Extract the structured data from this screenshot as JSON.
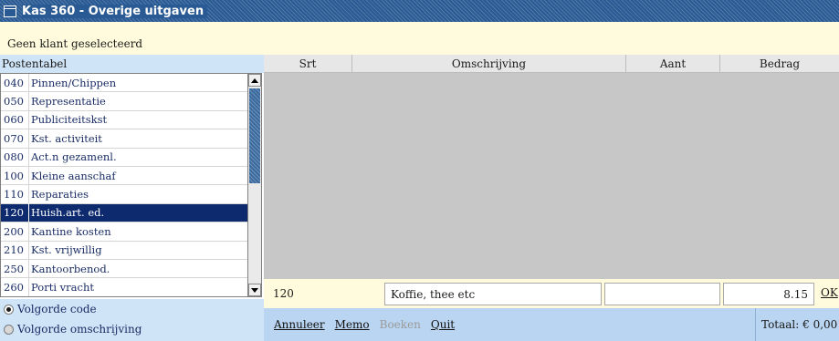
{
  "window": {
    "title": "Kas 360 - Overige uitgaven"
  },
  "customer": {
    "status": "Geen klant geselecteerd"
  },
  "postentabel": {
    "header": "Postentabel",
    "items": [
      {
        "code": "040",
        "label": "Pinnen/Chippen",
        "selected": false
      },
      {
        "code": "050",
        "label": "Representatie",
        "selected": false
      },
      {
        "code": "060",
        "label": "Publiciteitskst",
        "selected": false
      },
      {
        "code": "070",
        "label": "Kst. activiteit",
        "selected": false
      },
      {
        "code": "080",
        "label": "Act.n gezamenl.",
        "selected": false
      },
      {
        "code": "100",
        "label": "Kleine aanschaf",
        "selected": false
      },
      {
        "code": "110",
        "label": "Reparaties",
        "selected": false
      },
      {
        "code": "120",
        "label": "Huish.art. ed.",
        "selected": true
      },
      {
        "code": "200",
        "label": "Kantine kosten",
        "selected": false
      },
      {
        "code": "210",
        "label": "Kst. vrijwillig",
        "selected": false
      },
      {
        "code": "250",
        "label": "Kantoorbenod.",
        "selected": false
      },
      {
        "code": "260",
        "label": "Porti vracht",
        "selected": false
      }
    ]
  },
  "sort": {
    "options": [
      {
        "label": "Volgorde code",
        "checked": true
      },
      {
        "label": "Volgorde omschrijving",
        "checked": false
      }
    ]
  },
  "grid": {
    "columns": {
      "srt": "Srt",
      "omschrijving": "Omschrijving",
      "aant": "Aant",
      "bedrag": "Bedrag"
    }
  },
  "entry": {
    "code": "120",
    "omschrijving": "Koffie, thee etc",
    "aant": "",
    "bedrag": "8.15",
    "ok_label": "OK"
  },
  "actions": {
    "annuleer": "Annuleer",
    "memo": "Memo",
    "boeken": "Boeken",
    "quit": "Quit"
  },
  "totaal": "Totaal: € 0,00",
  "colors": {
    "titlebar": "#2a5a94",
    "selected_row": "#0d2a6e",
    "panel_blue": "#cfe4f6",
    "entry_yellow": "#fffbdc",
    "grid_grey": "#c7c7c7"
  }
}
